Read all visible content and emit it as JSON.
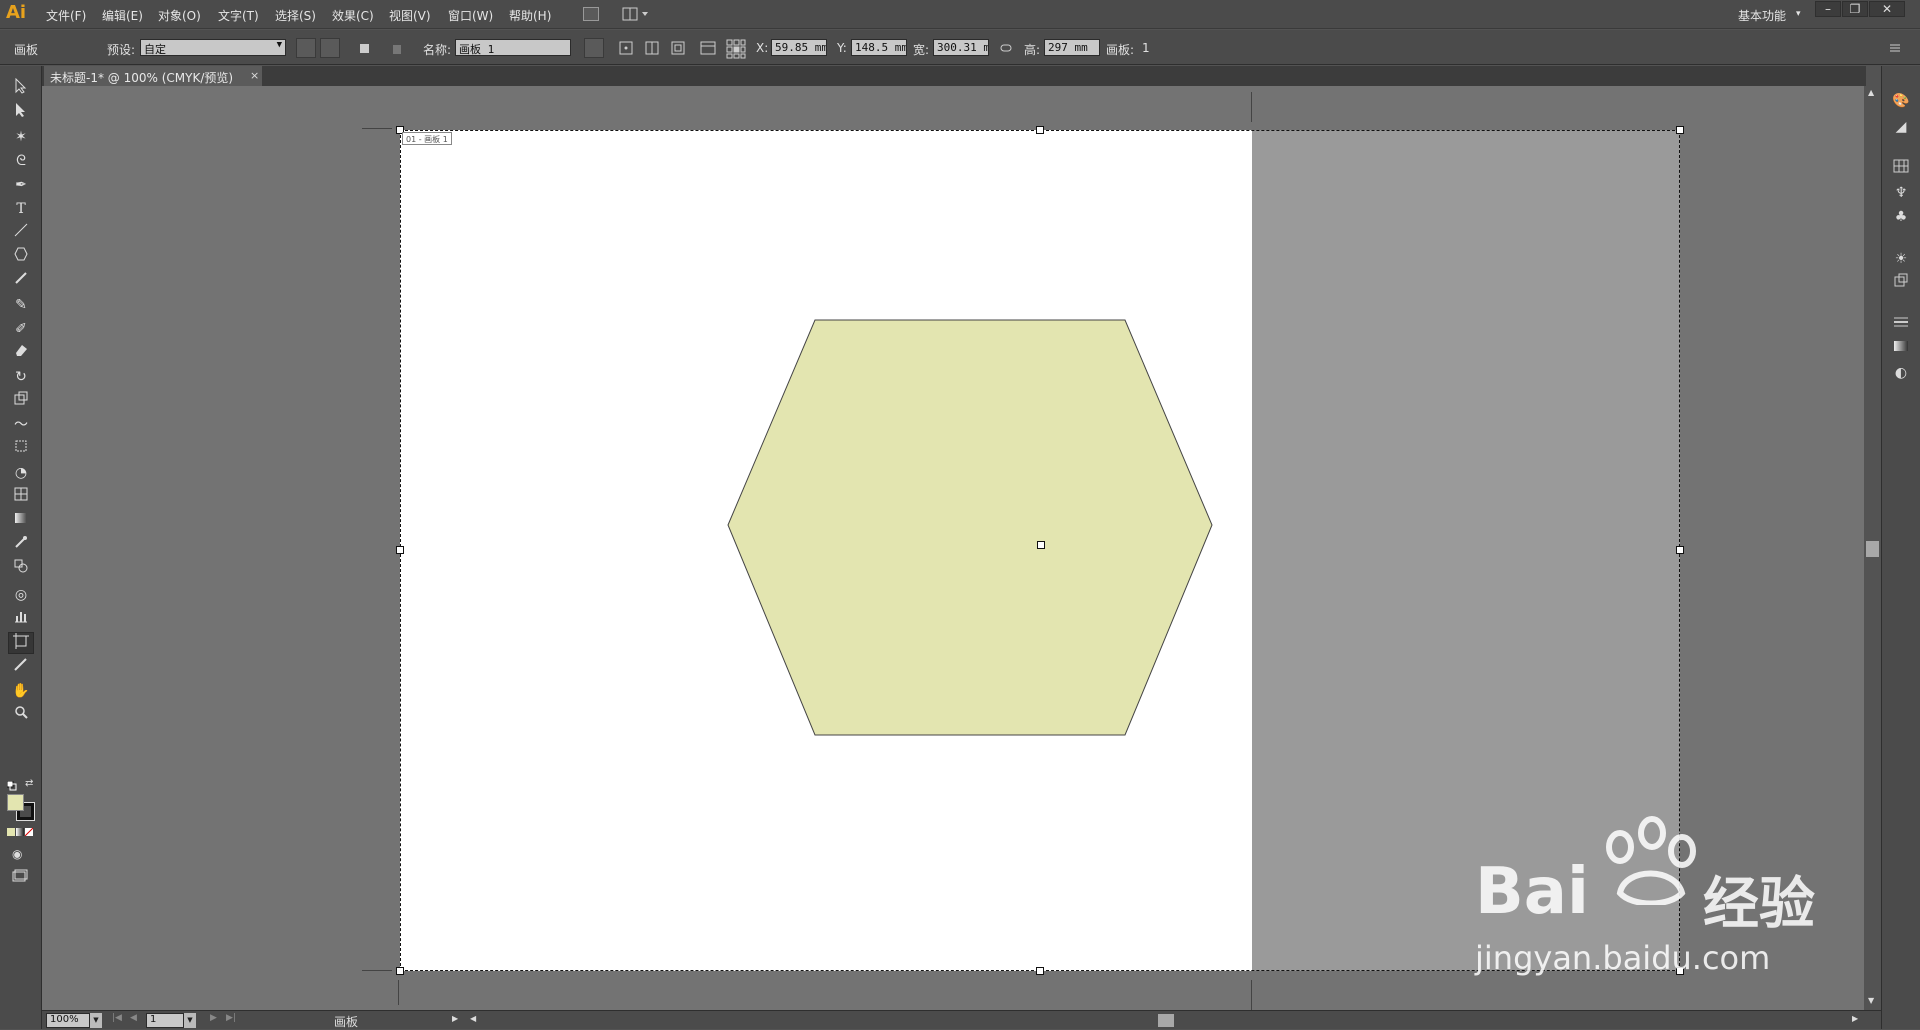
{
  "app": {
    "logo_text": "Ai",
    "workspace": "基本功能"
  },
  "menu": [
    {
      "label": "文件(F)"
    },
    {
      "label": "编辑(E)"
    },
    {
      "label": "对象(O)"
    },
    {
      "label": "文字(T)"
    },
    {
      "label": "选择(S)"
    },
    {
      "label": "效果(C)"
    },
    {
      "label": "视图(V)"
    },
    {
      "label": "窗口(W)"
    },
    {
      "label": "帮助(H)"
    }
  ],
  "control": {
    "mode_label": "画板",
    "preset_label": "预设:",
    "preset_value": "自定",
    "name_label": "名称:",
    "name_value": "画板 1",
    "x_label": "X:",
    "x_value": "59.85 mm",
    "y_label": "Y:",
    "y_value": "148.5 mm",
    "w_label": "宽:",
    "w_value": "300.31 m",
    "h_label": "高:",
    "h_value": "297 mm",
    "artboards_label": "画板:",
    "artboards_value": "1"
  },
  "document": {
    "tab_title": "未标题-1* @ 100% (CMYK/预览)",
    "artboard_label": "01 - 画板 1",
    "hexagon_fill": "#e3e5b0",
    "outside_fill": "#9a9a9a"
  },
  "tools": [
    "selection-tool",
    "direct-selection-tool",
    "magic-wand-tool",
    "lasso-tool",
    "pen-tool",
    "type-tool",
    "line-segment-tool",
    "polygon-tool",
    "paintbrush-tool",
    "pencil-tool",
    "blob-brush-tool",
    "eraser-tool",
    "rotate-tool",
    "scale-tool",
    "warp-tool",
    "free-transform-tool",
    "shape-builder-tool",
    "mesh-tool",
    "gradient-tool",
    "eyedropper-tool",
    "blend-tool",
    "symbol-sprayer-tool",
    "column-graph-tool",
    "artboard-tool",
    "slice-tool",
    "hand-tool",
    "zoom-tool"
  ],
  "colors": {
    "fill": "#e3e5b0",
    "stroke": "#111111"
  },
  "status": {
    "zoom": "100%",
    "page": "1",
    "mode": "画板"
  },
  "watermark": {
    "brand": "Bai",
    "brand_cn": "经验",
    "url": "jingyan.baidu.com"
  }
}
